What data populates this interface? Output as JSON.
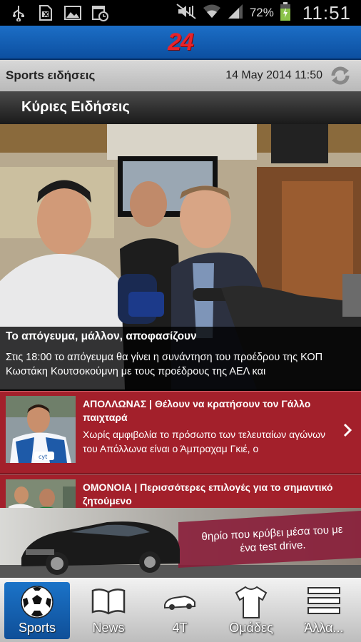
{
  "status_bar": {
    "battery": "72%",
    "time": "11:51",
    "icons": [
      "usb-icon",
      "sim-icon",
      "image-icon",
      "calendar-icon",
      "mute-icon",
      "wifi-icon",
      "signal-icon",
      "battery-icon"
    ]
  },
  "app": {
    "logo": "24",
    "brand_color": "#e8232a",
    "header_color": "#1565c0"
  },
  "info_bar": {
    "section": "Sports ειδήσεις",
    "date": "14 May 2014 11:50"
  },
  "section_header": {
    "label": "Κύριες Ειδήσεις"
  },
  "hero": {
    "title": "Το απόγευμα, μάλλον, αποφασίζουν",
    "summary": "Στις 18:00 το απόγευμα θα γίνει η συνάντηση του προέδρου της ΚΟΠ Κωστάκη Κουτσοκούμνη με τους προέδρους της ΑΕΛ και"
  },
  "news": [
    {
      "title": "ΑΠΟΛΛΩΝΑΣ | Θέλουν να κρατήσουν τον Γάλλο παιχταρά",
      "summary": "Χωρίς αμφιβολία το πρόσωπο των τελευταίων αγώνων του Απόλλωνα είναι ο Άμπραχαμ Γκιέ, ο"
    },
    {
      "title": "ΟΜΟΝΟΙΑ | Περισσότερες επιλογές για το σημαντικό ζητούμενο",
      "summary": ""
    }
  ],
  "ad": {
    "text": "θηρίο που κρύβει μέσα του με ένα test drive."
  },
  "bottom_nav": {
    "tabs": [
      {
        "label": "Sports",
        "icon": "soccer-ball-icon",
        "active": true
      },
      {
        "label": "News",
        "icon": "book-icon",
        "active": false
      },
      {
        "label": "4T",
        "icon": "car-icon",
        "active": false
      },
      {
        "label": "Ομάδες",
        "icon": "jersey-icon",
        "active": false
      },
      {
        "label": "Άλλα...",
        "icon": "menu-icon",
        "active": false
      }
    ]
  }
}
